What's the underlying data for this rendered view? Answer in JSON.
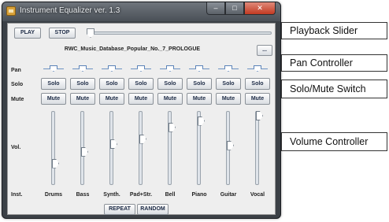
{
  "window": {
    "title": "Instrument Equalizer ver. 1.3",
    "minimize_icon": "minimize-icon",
    "maximize_icon": "maximize-icon",
    "close_icon": "close-icon",
    "app_icon": "equalizer-app-icon"
  },
  "transport": {
    "play_label": "PLAY",
    "stop_label": "STOP",
    "playback_position": 0.0
  },
  "song": {
    "title": "RWC_Music_Database_Popular_No._7_PROLOGUE",
    "browse_label": "..."
  },
  "rows": {
    "pan_label": "Pan",
    "solo_label": "Solo",
    "mute_label": "Mute",
    "vol_label": "Vol.",
    "inst_label": "Inst."
  },
  "channels": [
    {
      "name": "Drums",
      "solo": "Solo",
      "mute": "Mute",
      "pan": 0.5,
      "volume": 0.26
    },
    {
      "name": "Bass",
      "solo": "Solo",
      "mute": "Mute",
      "pan": 0.5,
      "volume": 0.44
    },
    {
      "name": "Synth.",
      "solo": "Solo",
      "mute": "Mute",
      "pan": 0.5,
      "volume": 0.56
    },
    {
      "name": "Pad+Str.",
      "solo": "Solo",
      "mute": "Mute",
      "pan": 0.5,
      "volume": 0.64
    },
    {
      "name": "Bell",
      "solo": "Solo",
      "mute": "Mute",
      "pan": 0.5,
      "volume": 0.82
    },
    {
      "name": "Piano",
      "solo": "Solo",
      "mute": "Mute",
      "pan": 0.5,
      "volume": 0.92
    },
    {
      "name": "Guitar",
      "solo": "Solo",
      "mute": "Mute",
      "pan": 0.5,
      "volume": 0.54
    },
    {
      "name": "Vocal",
      "solo": "Solo",
      "mute": "Mute",
      "pan": 0.5,
      "volume": 1.0
    }
  ],
  "bottom": {
    "repeat_label": "REPEAT",
    "random_label": "RANDOM"
  },
  "callouts": {
    "playback_slider": "Playback Slider",
    "pan_controller": "Pan Controller",
    "solo_mute_switch": "Solo/Mute Switch",
    "volume_controller": "Volume Controller"
  }
}
